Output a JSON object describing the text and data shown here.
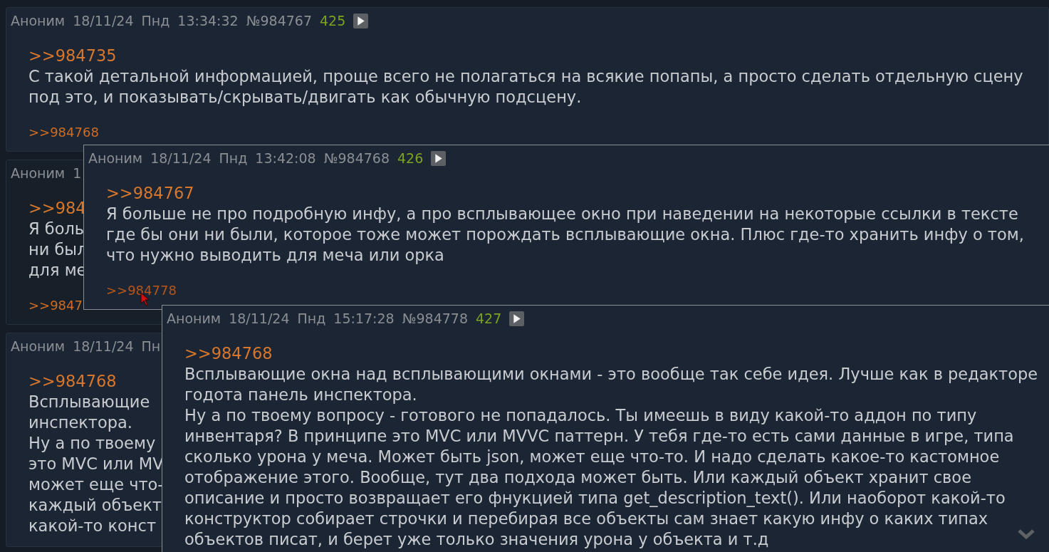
{
  "posts": [
    {
      "header": {
        "author": "Аноним",
        "date": "18/11/24",
        "weekday": "Пнд",
        "time": "13:34:32",
        "number": "№984767",
        "count": "425",
        "play": true
      },
      "reply_link": ">>984735",
      "paragraphs": [
        [
          "С такой детальной информацией, проще всего не полагаться на всякие попапы, а просто сделать отдельную сцену",
          "под это, и показывать/скрывать/двигать как обычную подсцену."
        ]
      ],
      "backlink": ">>984768"
    },
    {
      "header": {
        "author": "Аноним",
        "date": "1"
      },
      "reply_link": ">>984",
      "paragraphs": [
        [
          "Я боль",
          "ни был",
          "для ме"
        ]
      ],
      "backlink": ">>9847"
    },
    {
      "header": {
        "author": "Аноним",
        "date": "18/11/24",
        "weekday": "Пн"
      },
      "reply_link": ">>984768",
      "paragraphs": [
        [
          "Всплывающие",
          "инспектора."
        ],
        [
          "Ну а по твоему",
          "это MVC или MV",
          "может еще что-",
          "каждый объект",
          "какой-то конст"
        ]
      ]
    }
  ],
  "popups": [
    {
      "header": {
        "author": "Аноним",
        "date": "18/11/24",
        "weekday": "Пнд",
        "time": "13:42:08",
        "number": "№984768",
        "count": "426",
        "play": true
      },
      "reply_link": ">>984767",
      "paragraphs": [
        [
          "Я больше не про подробную инфу, а про всплывающее окно при наведении на некоторые ссылки в тексте",
          "где бы они ни были, которое тоже может порождать всплывающие окна. Плюс где-то хранить инфу о том,",
          "что нужно выводить для меча или орка"
        ]
      ],
      "backlink": ">>984778",
      "backlink_hovered": true
    },
    {
      "header": {
        "author": "Аноним",
        "date": "18/11/24",
        "weekday": "Пнд",
        "time": "15:17:28",
        "number": "№984778",
        "count": "427",
        "play": true
      },
      "reply_link": ">>984768",
      "paragraphs": [
        [
          "Всплывающие окна над всплывающими окнами - это вообще так себе идея. Лучше как в редакторе",
          "годота панель инспектора."
        ],
        [
          "Ну а по твоему вопросу - готового не попадалось. Ты имеешь в виду какой-то аддон по типу",
          "инвентаря? В принципе это MVC или MVVC паттерн. У тебя где-то есть сами данные в игре, типа",
          "сколько урона у меча. Может быть json, может еще что-то. И надо сделать какое-то кастомное",
          "отображение этого. Вообще, тут два подхода может быть. Или каждый объект хранит свое",
          "описание и просто возвращает его фнукцией типа get_description_text(). Или наоборот какой-то",
          "конструктор собирает строчки и перебирая все объекты сам знает какую инфу о каких типах",
          "объектов писат, и берет уже только значения урона у объекта и т.д"
        ]
      ]
    }
  ]
}
